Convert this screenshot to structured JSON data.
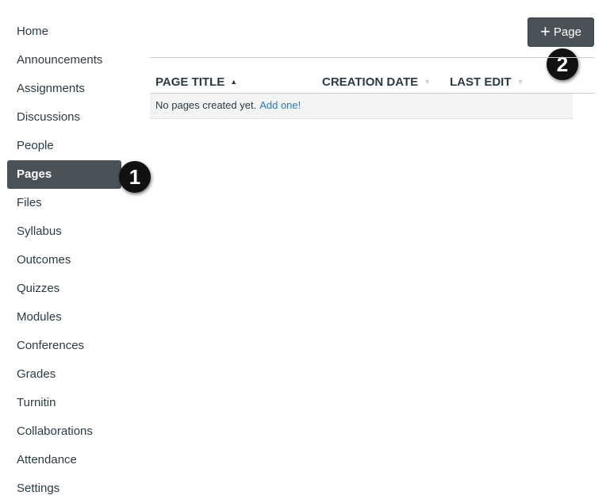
{
  "sidebar": {
    "items": [
      {
        "label": "Home"
      },
      {
        "label": "Announcements"
      },
      {
        "label": "Assignments"
      },
      {
        "label": "Discussions"
      },
      {
        "label": "People"
      },
      {
        "label": "Pages",
        "active": true
      },
      {
        "label": "Files"
      },
      {
        "label": "Syllabus"
      },
      {
        "label": "Outcomes"
      },
      {
        "label": "Quizzes"
      },
      {
        "label": "Modules"
      },
      {
        "label": "Conferences"
      },
      {
        "label": "Grades"
      },
      {
        "label": "Turnitin"
      },
      {
        "label": "Collaborations"
      },
      {
        "label": "Attendance"
      },
      {
        "label": "Settings"
      }
    ]
  },
  "toolbar": {
    "add_page_icon": "plus-icon",
    "add_page_label": "Page"
  },
  "table": {
    "columns": [
      {
        "label": "PAGE TITLE",
        "sort_icon": "sort-ascending-icon"
      },
      {
        "label": "CREATION DATE",
        "sort_icon": "sort-inactive-icon"
      },
      {
        "label": "LAST EDIT",
        "sort_icon": "sort-inactive-icon"
      }
    ],
    "empty_message": "No pages created yet.",
    "empty_link": "Add one!"
  },
  "callouts": {
    "first": "1",
    "second": "2"
  },
  "colors": {
    "active_nav_bg": "#4a5258",
    "button_bg": "#4a5258",
    "link": "#2b7abc",
    "text": "#2d3b45",
    "callout_bg": "#111111"
  }
}
